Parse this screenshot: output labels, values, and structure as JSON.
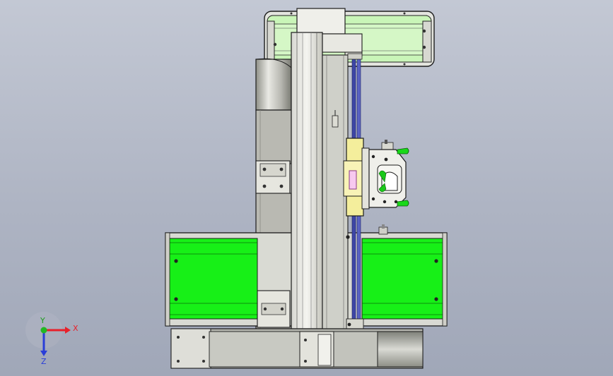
{
  "triad": {
    "x_label": "X",
    "y_label": "Y",
    "z_label": "Z",
    "x_color": "#e8202a",
    "y_color": "#22b822",
    "z_color": "#2a3ed8"
  },
  "colors": {
    "background_top": "#c3c8d4",
    "background_bottom": "#a0a7b8",
    "housing_green": "#17f017",
    "housing_light_green": "#c9f5b8",
    "column_grey": "#bdbdb7",
    "carriage_yellow": "#f4ee9c",
    "belt_blue": "#3d46a6"
  }
}
